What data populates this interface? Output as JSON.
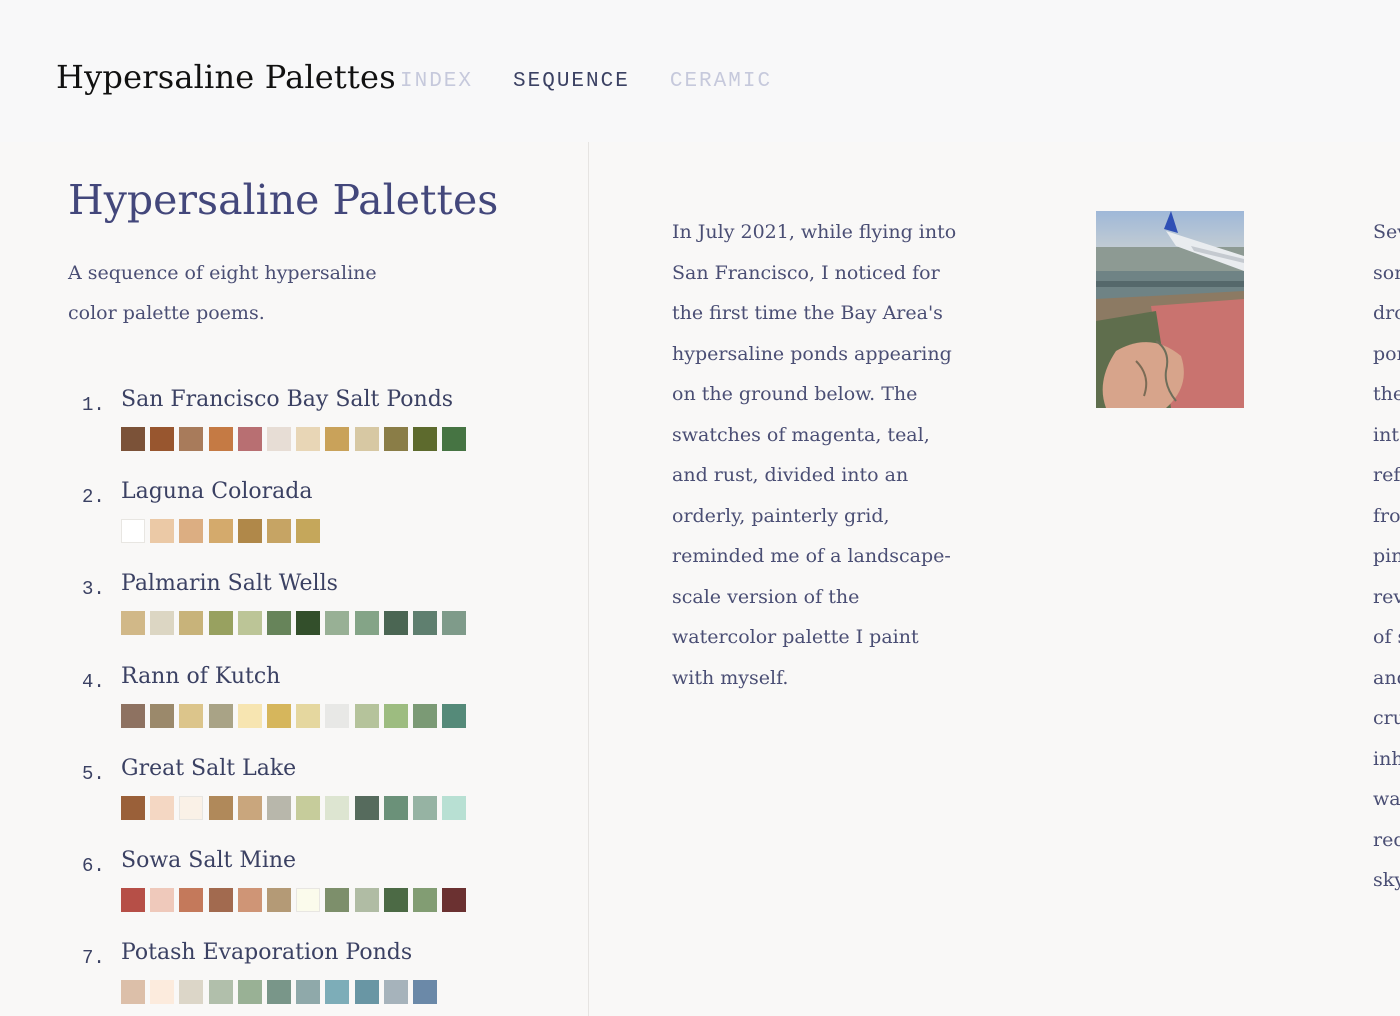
{
  "header": {
    "site_title": "Hypersaline Palettes",
    "nav": [
      {
        "label": "INDEX",
        "active": false
      },
      {
        "label": "SEQUENCE",
        "active": true
      },
      {
        "label": "CERAMIC",
        "active": false
      }
    ]
  },
  "sidebar": {
    "heading": "Hypersaline Palettes",
    "intro": "A sequence of eight hypersaline color palette poems.",
    "palettes": [
      {
        "number": "1.",
        "name": "San Francisco Bay Salt Ponds",
        "colors": [
          "#7b5238",
          "#98562f",
          "#a87b5b",
          "#c57a44",
          "#b86f72",
          "#e7ddd5",
          "#e8d6b6",
          "#c9a25a",
          "#d7c8a3",
          "#8a7d47",
          "#5d6a2d",
          "#467443"
        ]
      },
      {
        "number": "2.",
        "name": "Laguna Colorada",
        "colors": [
          "#ffffff",
          "#ebc9a6",
          "#dcae82",
          "#d4aa6c",
          "#b08849",
          "#c6a464",
          "#c5a75b"
        ]
      },
      {
        "number": "3.",
        "name": "Palmarin Salt Wells",
        "colors": [
          "#d1b888",
          "#dcd6c3",
          "#c8b37a",
          "#98a160",
          "#bcc597",
          "#67845a",
          "#334f2b",
          "#98b095",
          "#84a487",
          "#4b6653",
          "#5f7f6f",
          "#7f9b8a"
        ]
      },
      {
        "number": "4.",
        "name": "Rann of Kutch",
        "colors": [
          "#8e7261",
          "#9b896b",
          "#dcc58b",
          "#a9a386",
          "#f7e5b1",
          "#d6b65c",
          "#e5d79f",
          "#e8e8e6",
          "#b5c39b",
          "#9dbc80",
          "#7b9a75",
          "#558a79"
        ]
      },
      {
        "number": "5.",
        "name": "Great Salt Lake",
        "colors": [
          "#9a6039",
          "#f4d7c3",
          "#faf1e7",
          "#b0895a",
          "#c9a67d",
          "#b8b7ab",
          "#c6cc9b",
          "#dde5d1",
          "#566b5d",
          "#6b9179",
          "#96b3a3",
          "#b8e0d3"
        ]
      },
      {
        "number": "6.",
        "name": "Sowa Salt Mine",
        "colors": [
          "#b64f47",
          "#efc9bb",
          "#c4795b",
          "#a26a4f",
          "#cf9576",
          "#b49a76",
          "#fbfbec",
          "#7d8f6b",
          "#b0bca4",
          "#4c6a45",
          "#829d73",
          "#6b3131"
        ]
      },
      {
        "number": "7.",
        "name": "Potash Evaporation Ponds",
        "colors": [
          "#dcbfa9",
          "#fcebdd",
          "#dcd6c8",
          "#b1bfab",
          "#99b195",
          "#799689",
          "#8fa9aa",
          "#7dadb8",
          "#6996a4",
          "#a6b3bb",
          "#6b89a8"
        ]
      }
    ]
  },
  "main": {
    "paragraph1": "In July 2021, while flying into San Francisco, I noticed for the first time the Bay Area's hypersaline ponds appearing on the ground below. The swatches of magenta, teal, and rust, divided into an orderly, painterly grid, reminded me of a landscape-scale version of the watercolor palette I paint with myself.",
    "paragraph1_lines": [
      "In July 2021, while flying into",
      "San Francisco, I noticed for",
      "the first time the Bay Area's",
      "hypersaline ponds appearing",
      "on the ground below. The",
      "swatches of magenta, teal,",
      "and rust, divided into an",
      "orderly, painterly grid,",
      "reminded me of a landscape-",
      "scale version of the",
      "watercolor palette I paint",
      "with myself."
    ],
    "paragraph2_fragments": [
      "Sev",
      "son",
      "dro",
      "pon",
      "the",
      "int",
      "ref",
      "fro",
      "pin",
      "rev",
      "of s",
      "and",
      "cru",
      "inh",
      "wa",
      "red",
      "sky"
    ]
  }
}
